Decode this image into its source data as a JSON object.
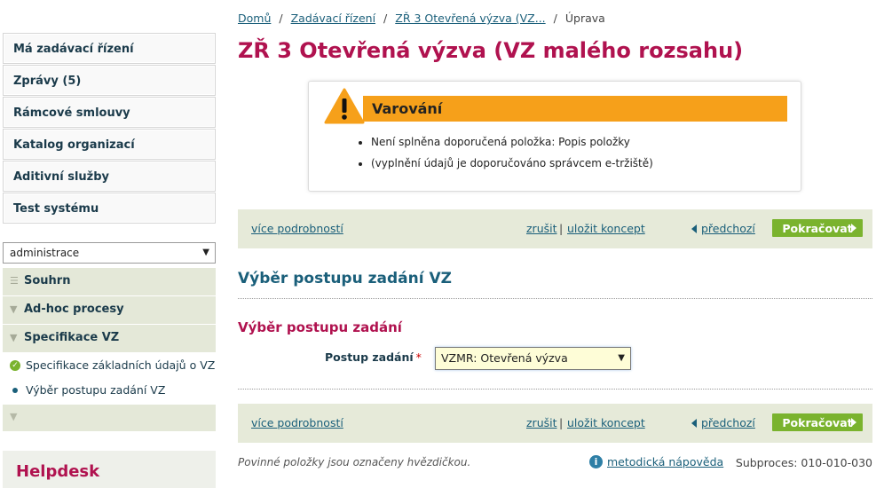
{
  "sidebar": {
    "menu": [
      {
        "label": "Má zadávací řízení"
      },
      {
        "label": "Zprávy (5)"
      },
      {
        "label": "Rámcové smlouvy"
      },
      {
        "label": "Katalog organizací"
      },
      {
        "label": "Aditivní služby"
      },
      {
        "label": "Test systému"
      }
    ],
    "admin_select": "administrace",
    "subnav": {
      "souhrn": "Souhrn",
      "adhoc": "Ad-hoc procesy",
      "spec": "Specifikace VZ",
      "spec_basic": "Specifikace základních údajů o VZ",
      "spec_choice": "Výběr postupu zadání VZ"
    },
    "helpdesk": "Helpdesk"
  },
  "breadcrumb": {
    "home": "Domů",
    "procedures": "Zadávací řízení",
    "current": "ZŘ 3 Otevřená výzva (VZ...",
    "edit": "Úprava"
  },
  "page_title": "ZŘ 3 Otevřená výzva (VZ malého rozsahu)",
  "warning": {
    "title": "Varování",
    "items": [
      "Není splněna doporučená položka: Popis položky",
      "(vyplnění údajů je doporučováno správcem e-tržiště)"
    ]
  },
  "actions": {
    "more_details": "více podrobností",
    "cancel": "zrušit",
    "separator": "|",
    "save_draft": "uložit koncept",
    "previous": "předchozí",
    "continue": "Pokračovat"
  },
  "section": {
    "title": "Výběr postupu zadání VZ",
    "subtitle": "Výběr postupu zadání",
    "field_label": "Postup zadání",
    "required_mark": "*",
    "field_value": "VZMR: Otevřená výzva"
  },
  "footer": {
    "note": "Povinné položky jsou označeny hvězdičkou.",
    "help": "metodická nápověda",
    "subprocess": "Subproces: 010-010-030"
  },
  "colors": {
    "brand": "#b0124f",
    "link": "#1a5f7a",
    "warning": "#f6a01a",
    "accent_green": "#7ab32e",
    "bar_bg": "#e6ead9"
  }
}
